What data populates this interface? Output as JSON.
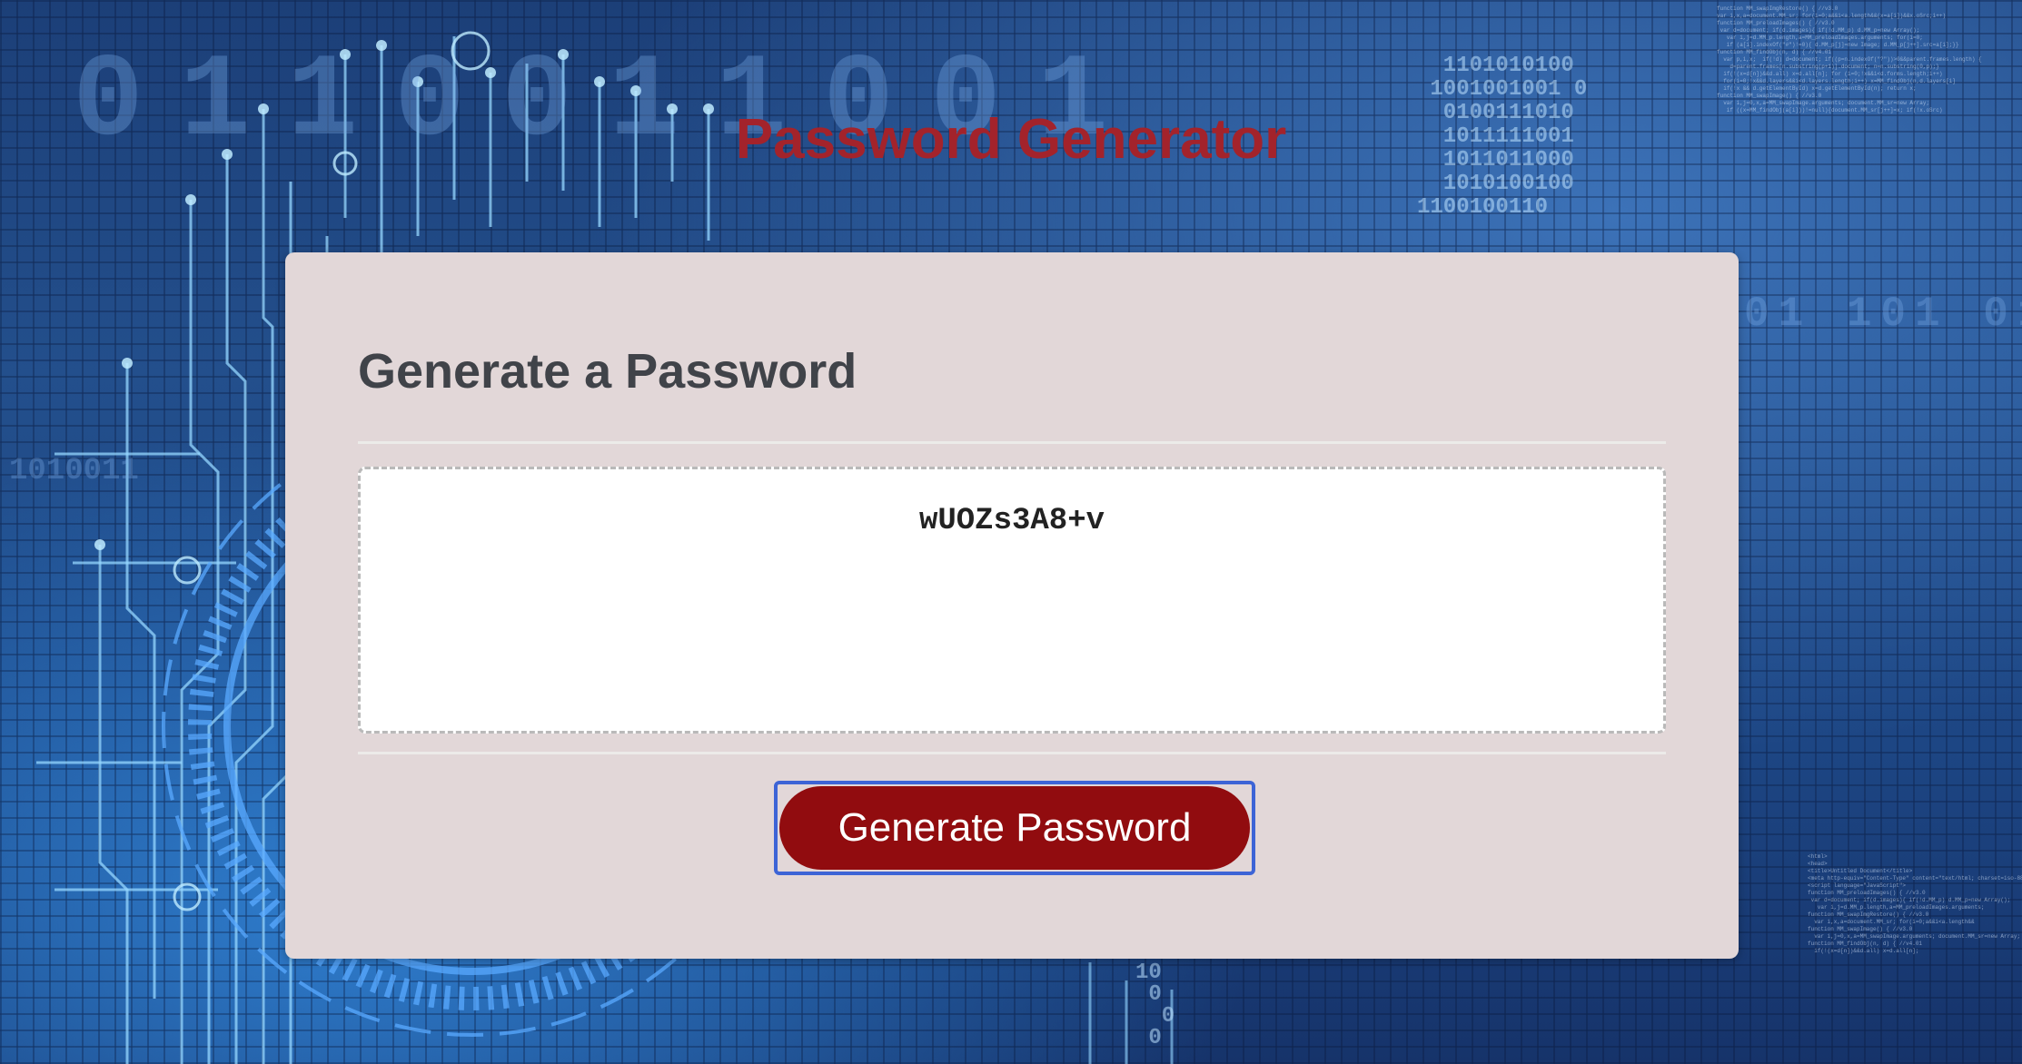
{
  "header": {
    "title": "Password Generator"
  },
  "card": {
    "heading": "Generate a Password",
    "password_value": "wUOZs3A8+v",
    "generate_button_label": "Generate Password"
  },
  "colors": {
    "title": "#a3232b",
    "card_bg": "#e2d7d8",
    "heading": "#404349",
    "button_bg": "#910c0f",
    "button_focus_ring": "#3d64d6"
  }
}
